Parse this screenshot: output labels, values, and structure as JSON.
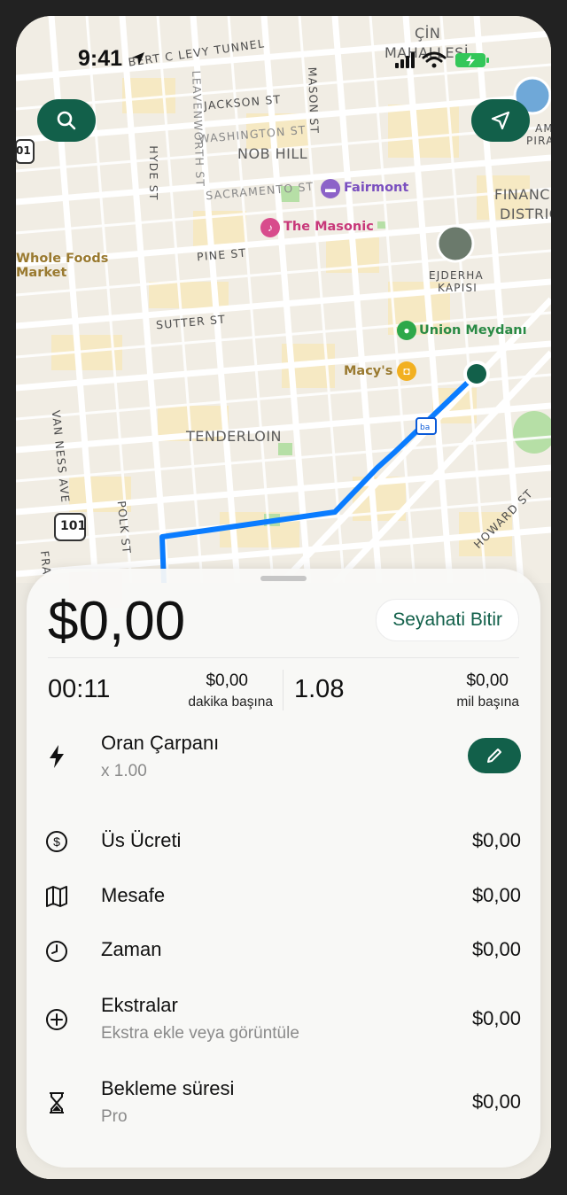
{
  "status_bar": {
    "time": "9:41"
  },
  "map": {
    "streets": {
      "tunnel": "BERT C LEVY TUNNEL",
      "jackson": "JACKSON ST",
      "washington": "WASHINGTON ST",
      "sacramento": "SACRAMENTO ST",
      "pine": "PINE ST",
      "sutter": "SUTTER ST",
      "hyde": "HYDE ST",
      "leavenworth": "LEAVENWORTH ST",
      "mason": "MASON ST",
      "polk": "POLK ST",
      "van_ness": "VAN NESS AVE",
      "howard": "HOWARD ST",
      "franklin": "FRA"
    },
    "districts": {
      "nob_hill": "NOB HILL",
      "tenderloin": "TENDERLOIN",
      "chinatown_1": "ÇİN",
      "chinatown_2": "MAHALLESİ",
      "financial_1": "FINANC",
      "financial_2": "DISTRIC"
    },
    "pois": {
      "fairmont": "Fairmont",
      "masonic": "The Masonic",
      "whole_foods_1": "Whole Foods",
      "whole_foods_2": "Market",
      "dragon_gate_1": "EJDERHA",
      "dragon_gate_2": "KAPISI",
      "union_square": "Union Meydanı",
      "macys": "Macy's",
      "pyramid_1": "AME",
      "pyramid_2": "PIRAMİD"
    },
    "shields": {
      "us101": "101",
      "us101_left": "01"
    },
    "route_color": "#0a7cff"
  },
  "trip": {
    "total": "$0,00",
    "end_button": "Seyahati Bitir",
    "elapsed": "00:11",
    "per_minute_value": "$0,00",
    "per_minute_label": "dakika başına",
    "distance": "1.08",
    "per_mile_value": "$0,00",
    "per_mile_label": "mil başına"
  },
  "fare_rows": [
    {
      "icon": "bolt-icon",
      "title": "Oran Çarpanı",
      "subtitle": "x 1.00",
      "amount": ""
    },
    {
      "icon": "dollar-circle-icon",
      "title": "Üs Ücreti",
      "subtitle": "",
      "amount": "$0,00"
    },
    {
      "icon": "map-icon",
      "title": "Mesafe",
      "subtitle": "",
      "amount": "$0,00"
    },
    {
      "icon": "clock-icon",
      "title": "Zaman",
      "subtitle": "",
      "amount": "$0,00"
    },
    {
      "icon": "plus-circle-icon",
      "title": "Ekstralar",
      "subtitle": "Ekstra ekle veya görüntüle",
      "amount": "$0,00"
    },
    {
      "icon": "hourglass-icon",
      "title": "Bekleme süresi",
      "subtitle": "Pro",
      "amount": "$0,00"
    }
  ],
  "colors": {
    "accent": "#12604a",
    "map_bg": "#f1ede4",
    "block_yellow": "#f6e9c3",
    "park_green": "#b6dfa6"
  }
}
